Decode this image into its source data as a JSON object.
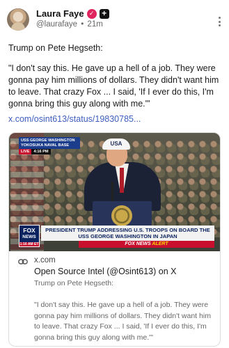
{
  "post": {
    "author_name": "Laura Faye",
    "handle": "@laurafaye",
    "separator": "•",
    "age": "21m",
    "verified_glyph": "✓",
    "plus_glyph": "+",
    "title": "Trump on Pete Hegseth:",
    "quote": "\"I don't say this. He gave up a hell of a job. They were gonna pay him millions of dollars. They didn't want him to leave. That crazy Fox ... I said, 'If I ever do this, I'm gonna bring this guy along with me.'\"",
    "link_text": "x.com/osint613/status/19830785..."
  },
  "embed": {
    "domain": "x.com",
    "title": "Open Source Intel (@Osint613) on X",
    "subtitle": "Trump on Pete Hegseth:",
    "quote": "\"I don't say this. He gave up a hell of a job. They were gonna pay him millions of dollars. They didn't want him to leave. That crazy Fox ... I said, 'If I ever do this, I'm gonna bring this guy along with me.'\"",
    "video": {
      "location_tag": "USS GEORGE WASHINGTON YOKOSUKA NAVAL BASE",
      "live": "LIVE",
      "time": "4:16 PM",
      "cap_text": "USA",
      "network_logo": "FOX",
      "network_logo_sub": "NEWS",
      "logo_clock": "1:16 AM ET",
      "headline": "PRESIDENT TRUMP ADDRESSING U.S. TROOPS ON BOARD THE USS GEORGE WASHINGTON IN JAPAN",
      "alert_prefix": "FOX NEWS",
      "alert_word": "ALERT"
    }
  },
  "icons": {
    "more": "more-vertical-icon",
    "link": "link-chain-icon",
    "verified": "verified-badge-icon",
    "plus": "plus-badge-icon"
  },
  "colors": {
    "link": "#3d5dbf",
    "verified": "#e0245e",
    "fox_red": "#c8102e",
    "fox_blue": "#0b2460"
  }
}
